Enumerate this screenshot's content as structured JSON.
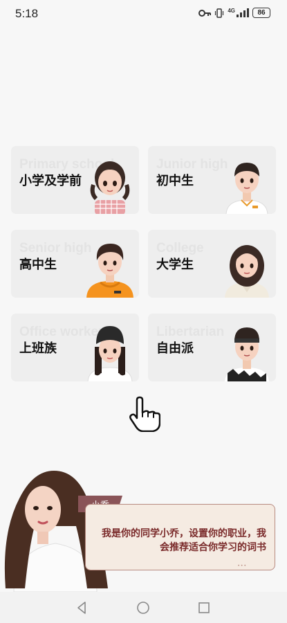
{
  "status_bar": {
    "time": "5:18",
    "network": "4G",
    "battery": "86",
    "icons": [
      "key-icon",
      "vibrate-icon",
      "signal-icon",
      "battery-icon"
    ]
  },
  "cards": [
    {
      "id": "primary",
      "label": "小学及学前",
      "watermark": "Primary school",
      "avatar": "girl-pigtails"
    },
    {
      "id": "junior",
      "label": "初中生",
      "watermark": "Junior high",
      "avatar": "boy-polo"
    },
    {
      "id": "senior",
      "label": "高中生",
      "watermark": "Senior high",
      "avatar": "boy-hoodie"
    },
    {
      "id": "college",
      "label": "大学生",
      "watermark": "College",
      "avatar": "woman-wavy"
    },
    {
      "id": "office",
      "label": "上班族",
      "watermark": "Office worker",
      "avatar": "woman-beanie"
    },
    {
      "id": "libertarian",
      "label": "自由派",
      "watermark": "Libertarian",
      "avatar": "man-headband"
    }
  ],
  "assistant": {
    "name": "小乔",
    "message": "我是你的同学小乔，设置你的职业，我会推荐适合你学习的词书"
  },
  "colors": {
    "card_bg": "#eeeeee",
    "name_tag": "#8a5458",
    "dialog_bg": "#f5ebe2",
    "dialog_text": "#7a2a2a"
  }
}
